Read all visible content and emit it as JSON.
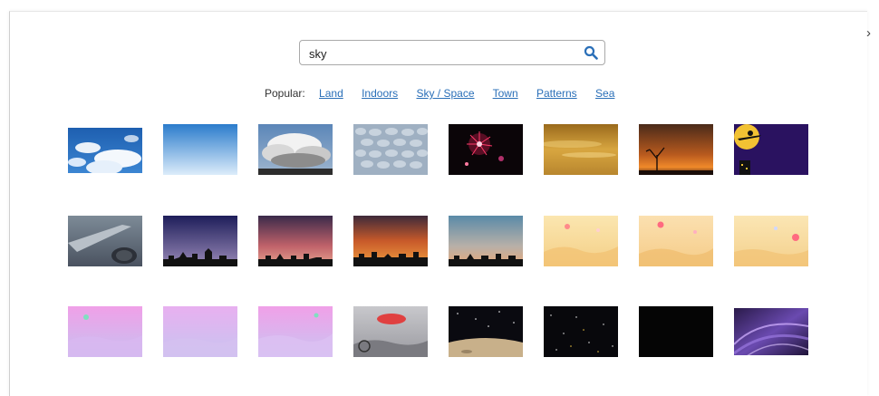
{
  "nav": {
    "next_icon": "chevron-right-icon",
    "next_glyph": "›"
  },
  "search": {
    "value": "sky",
    "icon": "search-icon",
    "icon_color": "#2a6fb8"
  },
  "popular": {
    "label": "Popular:",
    "links": [
      "Land",
      "Indoors",
      "Sky / Space",
      "Town",
      "Patterns",
      "Sea"
    ]
  },
  "colors": {
    "link": "#2a6fb8"
  },
  "thumbnails": [
    {
      "name": "thumb-blue-sky-clouds"
    },
    {
      "name": "thumb-blue-gradient-sky"
    },
    {
      "name": "thumb-storm-clouds"
    },
    {
      "name": "thumb-mackerel-clouds"
    },
    {
      "name": "thumb-fireworks"
    },
    {
      "name": "thumb-golden-sky"
    },
    {
      "name": "thumb-sunset-tree"
    },
    {
      "name": "thumb-halloween-witch-moon"
    },
    {
      "name": "thumb-airplane-wing"
    },
    {
      "name": "thumb-night-city-skyline"
    },
    {
      "name": "thumb-dusk-city-skyline"
    },
    {
      "name": "thumb-orange-city-skyline"
    },
    {
      "name": "thumb-blue-orange-city-skyline"
    },
    {
      "name": "thumb-pastel-desert-1"
    },
    {
      "name": "thumb-pastel-desert-2"
    },
    {
      "name": "thumb-pastel-desert-3"
    },
    {
      "name": "thumb-pink-fantasy-1"
    },
    {
      "name": "thumb-pink-fantasy-2"
    },
    {
      "name": "thumb-pink-fantasy-3"
    },
    {
      "name": "thumb-grey-airship"
    },
    {
      "name": "thumb-moon-surface"
    },
    {
      "name": "thumb-starry-night"
    },
    {
      "name": "thumb-black-space"
    },
    {
      "name": "thumb-purple-swirl"
    }
  ]
}
